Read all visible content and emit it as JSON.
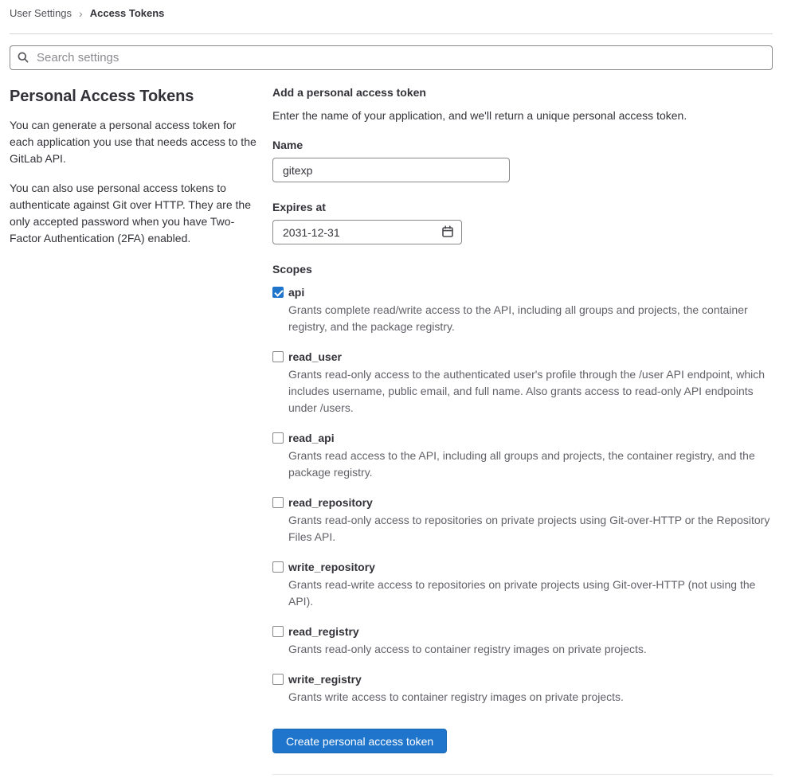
{
  "breadcrumb": {
    "items": [
      {
        "label": "User Settings"
      },
      {
        "label": "Access Tokens"
      }
    ],
    "separator": "›"
  },
  "search": {
    "placeholder": "Search settings"
  },
  "sidebar": {
    "title": "Personal Access Tokens",
    "paragraphs": {
      "p1": "You can generate a personal access token for each application you use that needs access to the GitLab API.",
      "p2": "You can also use personal access tokens to authenticate against Git over HTTP. They are the only accepted password when you have Two-Factor Authentication (2FA) enabled."
    }
  },
  "form": {
    "title": "Add a personal access token",
    "subtitle": "Enter the name of your application, and we'll return a unique personal access token.",
    "name_label": "Name",
    "name_value": "gitexp",
    "expires_label": "Expires at",
    "expires_value": "2031-12-31",
    "scopes_label": "Scopes",
    "scopes": [
      {
        "name": "api",
        "checked": true,
        "description": "Grants complete read/write access to the API, including all groups and projects, the container registry, and the package registry."
      },
      {
        "name": "read_user",
        "checked": false,
        "description": "Grants read-only access to the authenticated user's profile through the /user API endpoint, which includes username, public email, and full name. Also grants access to read-only API endpoints under /users."
      },
      {
        "name": "read_api",
        "checked": false,
        "description": "Grants read access to the API, including all groups and projects, the container registry, and the package registry."
      },
      {
        "name": "read_repository",
        "checked": false,
        "description": "Grants read-only access to repositories on private projects using Git-over-HTTP or the Repository Files API."
      },
      {
        "name": "write_repository",
        "checked": false,
        "description": "Grants read-write access to repositories on private projects using Git-over-HTTP (not using the API)."
      },
      {
        "name": "read_registry",
        "checked": false,
        "description": "Grants read-only access to container registry images on private projects."
      },
      {
        "name": "write_registry",
        "checked": false,
        "description": "Grants write access to container registry images on private projects."
      }
    ],
    "submit_label": "Create personal access token"
  },
  "colors": {
    "accent": "#1f75cb",
    "text_primary": "#333238",
    "text_secondary": "#626168",
    "border": "#89888d",
    "divider": "#dcdcde"
  }
}
